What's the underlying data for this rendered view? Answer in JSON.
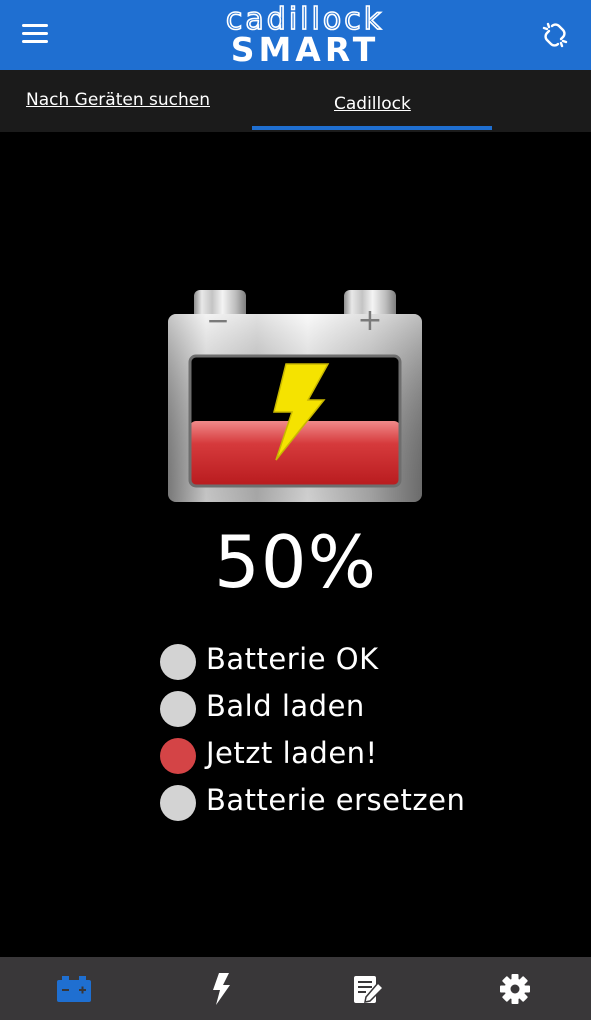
{
  "header": {
    "logo_top": "cadillock",
    "logo_bottom": "SMART",
    "menu_icon": "hamburger-menu-icon",
    "link_icon": "broken-link-icon"
  },
  "tabs": [
    {
      "label": "Nach Geräten suchen",
      "active": false
    },
    {
      "label": "Cadillock",
      "active": true
    }
  ],
  "battery": {
    "charge_fraction": 0.5,
    "percent_text": "50%",
    "fill_color": "#d51f22",
    "bolt_color": "#f5e300",
    "minus_symbol": "−",
    "plus_symbol": "+"
  },
  "status": [
    {
      "label": "Batterie OK",
      "active": false,
      "color": "#d3d3d3"
    },
    {
      "label": "Bald laden",
      "active": false,
      "color": "#d3d3d3"
    },
    {
      "label": "Jetzt laden!",
      "active": true,
      "color": "#d44446"
    },
    {
      "label": "Batterie ersetzen",
      "active": false,
      "color": "#d3d3d3"
    }
  ],
  "bottom_nav": [
    {
      "icon": "battery-icon",
      "active": true
    },
    {
      "icon": "lightning-icon",
      "active": false
    },
    {
      "icon": "notes-edit-icon",
      "active": false
    },
    {
      "icon": "settings-gear-icon",
      "active": false
    }
  ],
  "colors": {
    "header_bg": "#1f6fd1",
    "accent": "#1f6fd1",
    "tabbar_bg": "#1b1b1b",
    "nav_bg": "#393739"
  }
}
